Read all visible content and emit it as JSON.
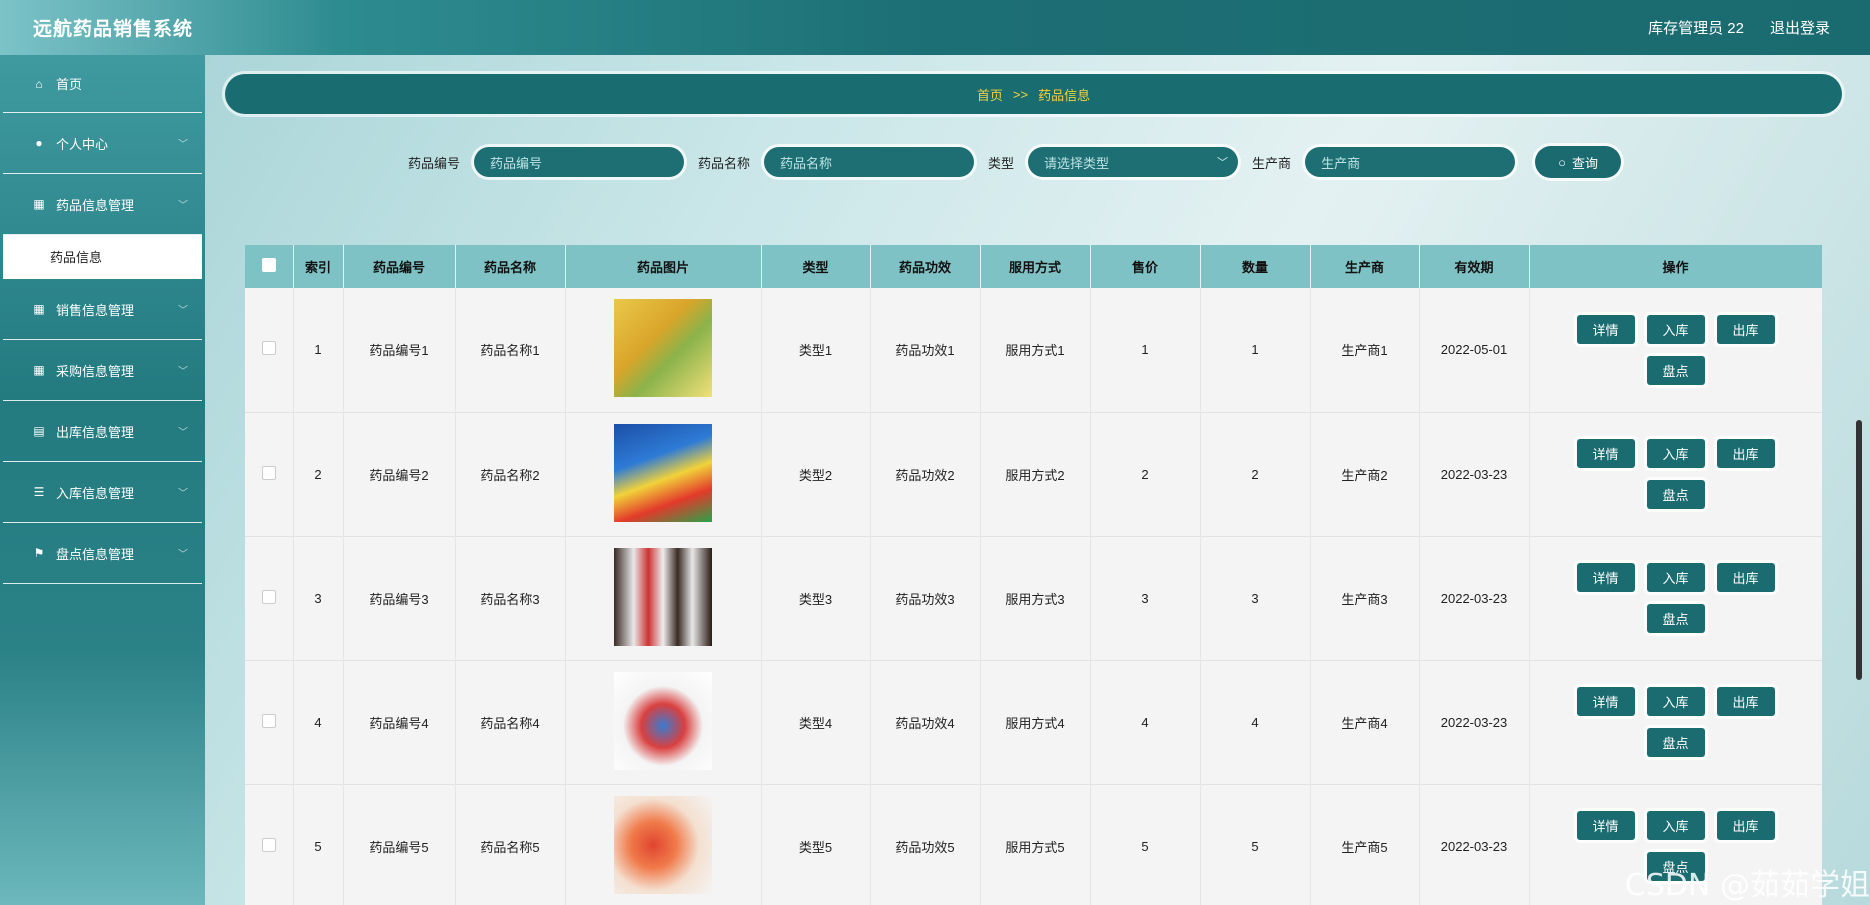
{
  "header": {
    "app_title": "远航药品销售系统",
    "user": "库存管理员 22",
    "logout": "退出登录"
  },
  "sidebar": {
    "items": [
      {
        "label": "首页",
        "icon": "home-icon"
      },
      {
        "label": "个人中心",
        "icon": "user-icon"
      },
      {
        "label": "药品信息管理",
        "icon": "grid-icon"
      },
      {
        "label": "药品信息",
        "icon": ""
      },
      {
        "label": "销售信息管理",
        "icon": "grid-icon"
      },
      {
        "label": "采购信息管理",
        "icon": "grid-icon"
      },
      {
        "label": "出库信息管理",
        "icon": "briefcase-icon"
      },
      {
        "label": "入库信息管理",
        "icon": "list-icon"
      },
      {
        "label": "盘点信息管理",
        "icon": "flag-icon"
      }
    ]
  },
  "breadcrumb": {
    "home": "首页",
    "sep": ">>",
    "current": "药品信息"
  },
  "search": {
    "code_label": "药品编号",
    "code_placeholder": "药品编号",
    "name_label": "药品名称",
    "name_placeholder": "药品名称",
    "type_label": "类型",
    "type_placeholder": "请选择类型",
    "maker_label": "生产商",
    "maker_placeholder": "生产商",
    "query": "查询"
  },
  "table": {
    "headers": [
      "",
      "索引",
      "药品编号",
      "药品名称",
      "药品图片",
      "类型",
      "药品功效",
      "服用方式",
      "售价",
      "数量",
      "生产商",
      "有效期",
      "操作"
    ],
    "rows": [
      {
        "idx": "1",
        "code": "药品编号1",
        "name": "药品名称1",
        "type": "类型1",
        "effect": "药品功效1",
        "usage": "服用方式1",
        "price": "1",
        "qty": "1",
        "maker": "生产商1",
        "expiry": "2022-05-01"
      },
      {
        "idx": "2",
        "code": "药品编号2",
        "name": "药品名称2",
        "type": "类型2",
        "effect": "药品功效2",
        "usage": "服用方式2",
        "price": "2",
        "qty": "2",
        "maker": "生产商2",
        "expiry": "2022-03-23"
      },
      {
        "idx": "3",
        "code": "药品编号3",
        "name": "药品名称3",
        "type": "类型3",
        "effect": "药品功效3",
        "usage": "服用方式3",
        "price": "3",
        "qty": "3",
        "maker": "生产商3",
        "expiry": "2022-03-23"
      },
      {
        "idx": "4",
        "code": "药品编号4",
        "name": "药品名称4",
        "type": "类型4",
        "effect": "药品功效4",
        "usage": "服用方式4",
        "price": "4",
        "qty": "4",
        "maker": "生产商4",
        "expiry": "2022-03-23"
      },
      {
        "idx": "5",
        "code": "药品编号5",
        "name": "药品名称5",
        "type": "类型5",
        "effect": "药品功效5",
        "usage": "服用方式5",
        "price": "5",
        "qty": "5",
        "maker": "生产商5",
        "expiry": "2022-03-23"
      }
    ],
    "actions": {
      "detail": "详情",
      "in": "入库",
      "out": "出库",
      "check": "盘点"
    }
  },
  "watermark": "CSDN @茹茹学姐"
}
